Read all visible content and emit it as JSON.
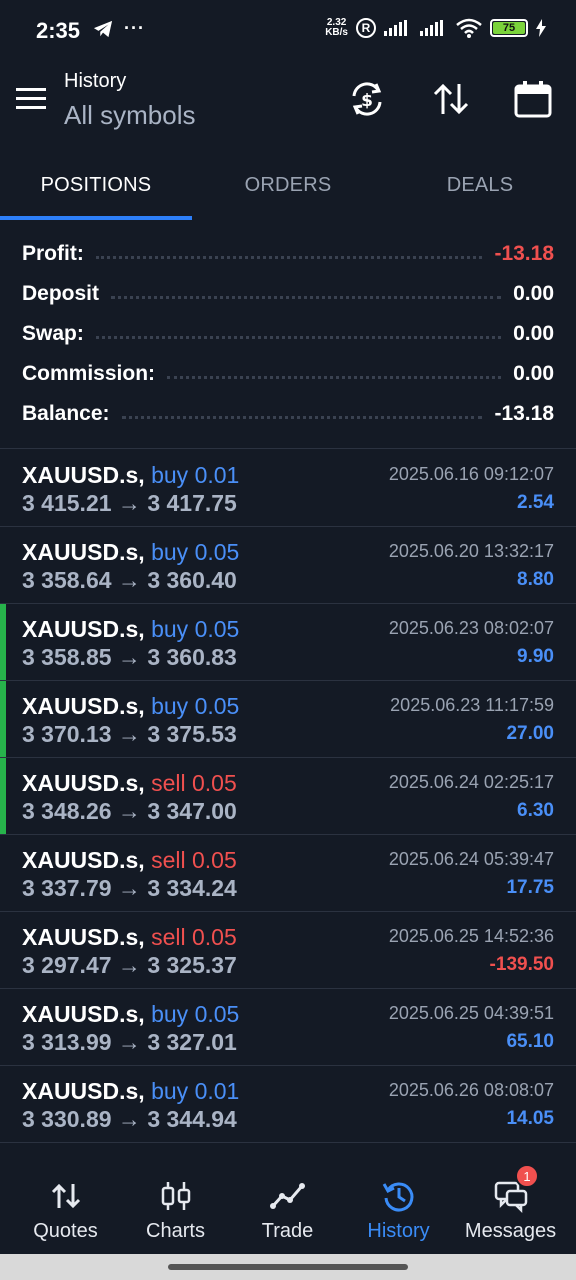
{
  "status_bar": {
    "time": "2:35",
    "net_speed_value": "2.32",
    "net_speed_unit": "KB/s",
    "registered_badge": "R",
    "battery_level": "75",
    "icons": [
      "telegram-icon",
      "more-icon",
      "signal-icon",
      "wifi-icon",
      "battery-icon",
      "charging-icon"
    ]
  },
  "header": {
    "title": "History",
    "subtitle": "All symbols",
    "icons": [
      "menu-icon",
      "currency-refresh-icon",
      "sort-icon",
      "calendar-icon"
    ]
  },
  "tabs": [
    {
      "label": "POSITIONS",
      "active": true
    },
    {
      "label": "ORDERS",
      "active": false
    },
    {
      "label": "DEALS",
      "active": false
    }
  ],
  "summary": [
    {
      "label": "Profit:",
      "value": "-13.18",
      "negative": true
    },
    {
      "label": "Deposit",
      "value": "0.00",
      "negative": false
    },
    {
      "label": "Swap:",
      "value": "0.00",
      "negative": false
    },
    {
      "label": "Commission:",
      "value": "0.00",
      "negative": false
    },
    {
      "label": "Balance:",
      "value": "-13.18",
      "negative": false
    }
  ],
  "positions": [
    {
      "symbol": "XAUUSD.s,",
      "type": "buy 0.01",
      "side": "buy",
      "open": "3 415.21",
      "close": "3 417.75",
      "time": "2025.06.16 09:12:07",
      "profit": "2.54",
      "accent": false
    },
    {
      "symbol": "XAUUSD.s,",
      "type": "buy 0.05",
      "side": "buy",
      "open": "3 358.64",
      "close": "3 360.40",
      "time": "2025.06.20 13:32:17",
      "profit": "8.80",
      "accent": false
    },
    {
      "symbol": "XAUUSD.s,",
      "type": "buy 0.05",
      "side": "buy",
      "open": "3 358.85",
      "close": "3 360.83",
      "time": "2025.06.23 08:02:07",
      "profit": "9.90",
      "accent": true
    },
    {
      "symbol": "XAUUSD.s,",
      "type": "buy 0.05",
      "side": "buy",
      "open": "3 370.13",
      "close": "3 375.53",
      "time": "2025.06.23 11:17:59",
      "profit": "27.00",
      "accent": true
    },
    {
      "symbol": "XAUUSD.s,",
      "type": "sell 0.05",
      "side": "sell",
      "open": "3 348.26",
      "close": "3 347.00",
      "time": "2025.06.24 02:25:17",
      "profit": "6.30",
      "accent": true
    },
    {
      "symbol": "XAUUSD.s,",
      "type": "sell 0.05",
      "side": "sell",
      "open": "3 337.79",
      "close": "3 334.24",
      "time": "2025.06.24 05:39:47",
      "profit": "17.75",
      "accent": false
    },
    {
      "symbol": "XAUUSD.s,",
      "type": "sell 0.05",
      "side": "sell",
      "open": "3 297.47",
      "close": "3 325.37",
      "time": "2025.06.25 14:52:36",
      "profit": "-139.50",
      "accent": false
    },
    {
      "symbol": "XAUUSD.s,",
      "type": "buy 0.05",
      "side": "buy",
      "open": "3 313.99",
      "close": "3 327.01",
      "time": "2025.06.25 04:39:51",
      "profit": "65.10",
      "accent": false
    },
    {
      "symbol": "XAUUSD.s,",
      "type": "buy 0.01",
      "side": "buy",
      "open": "3 330.89",
      "close": "3 344.94",
      "time": "2025.06.26 08:08:07",
      "profit": "14.05",
      "accent": false
    }
  ],
  "arrow": "→",
  "bottom_nav": [
    {
      "label": "Quotes",
      "icon": "quotes-icon",
      "active": false
    },
    {
      "label": "Charts",
      "icon": "candlestick-icon",
      "active": false
    },
    {
      "label": "Trade",
      "icon": "trade-chart-icon",
      "active": false
    },
    {
      "label": "History",
      "icon": "history-icon",
      "active": true
    },
    {
      "label": "Messages",
      "icon": "messages-icon",
      "active": false,
      "badge": "1"
    }
  ],
  "colors": {
    "background": "#141a25",
    "accent_blue": "#2d7ff9",
    "buy_blue": "#4a8ff7",
    "sell_red": "#f0504f",
    "active_green": "#27b34b"
  }
}
